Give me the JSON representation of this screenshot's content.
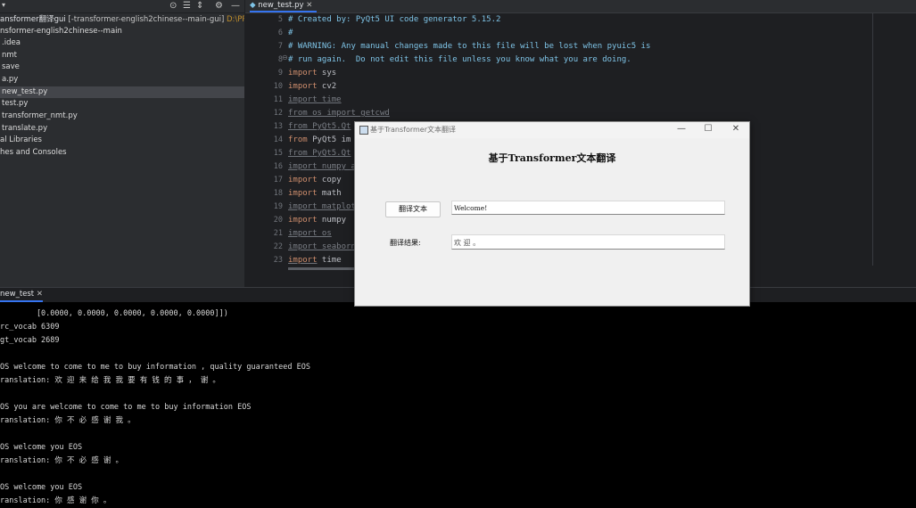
{
  "project": {
    "title_project": "ansformer翻译gui",
    "title_module": "[-transformer-english2chinese--main-gui]",
    "title_path": "D:\\PR",
    "items": [
      {
        "label": "nsformer-english2chinese--main"
      },
      {
        "label": ".idea"
      },
      {
        "label": "nmt"
      },
      {
        "label": "save"
      },
      {
        "label": "a.py"
      },
      {
        "label": "new_test.py"
      },
      {
        "label": "test.py"
      },
      {
        "label": "transformer_nmt.py"
      },
      {
        "label": "translate.py"
      },
      {
        "label": "al Libraries"
      },
      {
        "label": "hes and Consoles"
      }
    ]
  },
  "editor": {
    "tab_label": "new_test.py",
    "line_numbers": [
      "5",
      "6",
      "7",
      "8",
      "9",
      "10",
      "11",
      "12",
      "13",
      "14",
      "15",
      "16",
      "17",
      "18",
      "19",
      "20",
      "21",
      "22",
      "23"
    ],
    "lines": {
      "l5": "# Created by: PyQt5 UI code generator 5.15.2",
      "l6": "#",
      "l7": "# WARNING: Any manual changes made to this file will be lost when pyuic5 is",
      "l8": "# run again.  Do not edit this file unless you know what you are doing.",
      "l9_kw": "import",
      "l9_rest": " sys",
      "l10_kw": "import",
      "l10_rest": " cv2",
      "l11": "import time",
      "l12": "from os import getcwd",
      "l13": "from PyQt5.Qt",
      "l14_kw": "from",
      "l14_rest": " PyQt5 im",
      "l15": "from PyQt5.Qt",
      "l16": "import numpy a",
      "l17_kw": "import",
      "l17_rest": " copy",
      "l18_kw": "import",
      "l18_rest": " math",
      "l19": "import matplot",
      "l20_kw": "import",
      "l20_rest": " numpy",
      "l21": "import os",
      "l22": "import seaborn",
      "l23_kw": "import",
      "l23_rest": " time"
    }
  },
  "console": {
    "tab_label": "new_test",
    "lines": [
      "        [0.0000, 0.0000, 0.0000, 0.0000, 0.0000]])",
      "rc_vocab 6309",
      "gt_vocab 2689",
      "",
      "OS welcome to come to me to buy information , quality guaranteed EOS",
      "ranslation: 欢 迎 来 给 我 我 要 有 钱 的 事 ， 谢 。",
      "",
      "OS you are welcome to come to me to buy information EOS",
      "ranslation: 你 不 必 感 谢 我 。",
      "",
      "OS welcome you EOS",
      "ranslation: 你 不 必 感 谢 。",
      "",
      "OS welcome you EOS",
      "ranslation: 你 感 谢 你 。"
    ]
  },
  "dialog": {
    "window_title": "基于Transformer文本翻译",
    "heading": "基于Transformer文本翻译",
    "translate_button": "翻译文本",
    "input_value": "Welcome!",
    "result_label": "翻译结果:",
    "result_value": "欢 迎 。"
  },
  "colors": {
    "accent": "#3574f0",
    "keyword": "#cf8e6d",
    "comment": "#7ec3e6"
  }
}
